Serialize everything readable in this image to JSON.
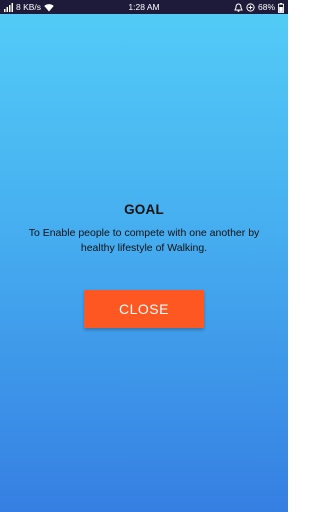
{
  "status_bar": {
    "speed": "8 KB/s",
    "time": "1:28 AM",
    "battery": "68%",
    "icons": [
      "signal-icon",
      "wifi-icon",
      "alarm-icon",
      "data-saver-icon",
      "battery-icon"
    ]
  },
  "goal": {
    "title": "GOAL",
    "description": "To Enable people to compete with one another by healthy lifestyle of Walking."
  },
  "actions": {
    "close_label": "CLOSE"
  },
  "colors": {
    "status_bar_bg": "#1e1b3a",
    "gradient_top": "#53cdf7",
    "gradient_bottom": "#357fe2",
    "close_button": "#ff5722"
  }
}
